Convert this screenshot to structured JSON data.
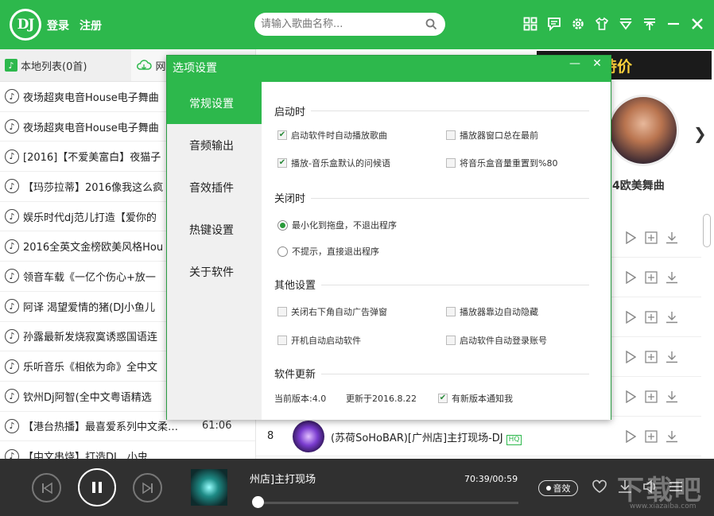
{
  "header": {
    "logo_text": "DJ",
    "login": "登录",
    "register": "注册",
    "search_placeholder": "请输入歌曲名称..."
  },
  "left": {
    "tabs": [
      {
        "label": "本地列表(0首)"
      },
      {
        "label": "网络"
      }
    ],
    "songs": [
      {
        "title": "夜场超爽电音House电子舞曲",
        "duration": ""
      },
      {
        "title": "夜场超爽电音House电子舞曲",
        "duration": ""
      },
      {
        "title": "[2016]【不爱美富白】夜猫子",
        "duration": ""
      },
      {
        "title": "【玛莎拉蒂】2016像我这么疯",
        "duration": ""
      },
      {
        "title": "娱乐时代dj范儿打造【爱你的",
        "duration": ""
      },
      {
        "title": "2016全英文金榜欧美风格Hou",
        "duration": ""
      },
      {
        "title": "领音车载《一亿个伤心+放一",
        "duration": ""
      },
      {
        "title": "阿译  渴望爱情的猪(DJ小鱼儿",
        "duration": ""
      },
      {
        "title": "孙露最新发烧寂寞诱惑国语连",
        "duration": ""
      },
      {
        "title": "乐听音乐《相依为命》全中文",
        "duration": ""
      },
      {
        "title": "钦州Dj阿智(全中文粤语精选",
        "duration": ""
      },
      {
        "title": "【港台热播】最喜爱系列中文柔…",
        "duration": "61:06"
      },
      {
        "title": "【中文串烧】打造DJ…小虫",
        "duration": ""
      }
    ]
  },
  "right": {
    "banner": "客风全场特价",
    "featured_title": "4欧美舞曲",
    "row8": {
      "num": "8",
      "title": "(苏荷SoHoBAR)[广州店]主打现场-DJ",
      "badge": "HQ"
    }
  },
  "dialog": {
    "title": "选项设置",
    "nav": [
      "常规设置",
      "音频输出",
      "音效插件",
      "热键设置",
      "关于软件"
    ],
    "sections": {
      "startup": "启动时",
      "close": "关闭时",
      "other": "其他设置",
      "update": "软件更新"
    },
    "options": {
      "autoplay": "启动软件时自动播放歌曲",
      "on_top": "播放器窗口总在最前",
      "greeting": "播放-音乐盒默认的问候语",
      "volume_reset": "将音乐盒音量重置到%80",
      "minimize_tray": "最小化到拖盘，不退出程序",
      "exit_direct": "不提示，直接退出程序",
      "close_ads": "关闭右下角自动广告弹窗",
      "auto_hide": "播放器靠边自动隐藏",
      "auto_start": "开机自动启动软件",
      "auto_login": "启动软件自动登录账号",
      "notify_update": "有新版本通知我"
    },
    "version_current": "当前版本:4.0",
    "version_updated": "更新于2016.8.22"
  },
  "player": {
    "track_title": "州店]主打现场",
    "time": "70:39/00:59",
    "effect_label": "音效",
    "progress": 0.02,
    "watermark": "下载吧",
    "watermark_url": "www.xiazaiba.com"
  }
}
